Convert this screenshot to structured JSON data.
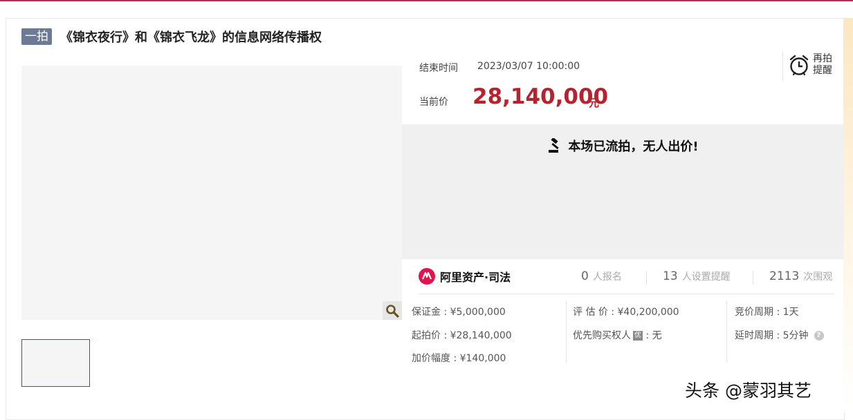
{
  "header": {
    "tag": "一拍",
    "title": "《锦衣夜行》和《锦衣飞龙》的信息网络传播权"
  },
  "auction": {
    "end_time_label": "结束时间",
    "end_time_value": "2023/03/07 10:00:00",
    "current_price_label": "当前价",
    "current_price_value": "28,140,000",
    "current_price_unit": "元",
    "remind_label": "再拍提醒",
    "status_text": "本场已流拍，无人出价!"
  },
  "stats": {
    "brand_name": "阿里资产·司法",
    "signups_value": "0",
    "signups_label": "人报名",
    "reminders_value": "13",
    "reminders_label": "人设置提醒",
    "views_value": "2113",
    "views_label": "次围观"
  },
  "details": {
    "deposit": "保证金 : ¥5,000,000",
    "starting_price": "起拍价 : ¥28,140,000",
    "increment": "加价幅度 : ¥140,000",
    "appraisal": "评 估 价 : ¥40,200,000",
    "priority_label": "优先购买权人",
    "priority_badge": "优",
    "priority_value": " : 无",
    "bidding_cycle": "竞价周期 : 1天",
    "extension_cycle": "延时周期 : 5分钟",
    "help_glyph": "?"
  },
  "watermark": "头条 @蒙羽其艺",
  "colors": {
    "accent_red": "#b8222e",
    "tag_bg": "#6d7a96",
    "top_line": "#a8305a",
    "brand_red": "#e0154f"
  },
  "icons": [
    "alarm-clock-icon",
    "gavel-icon",
    "brand-logo-icon",
    "zoom-icon",
    "help-icon"
  ]
}
